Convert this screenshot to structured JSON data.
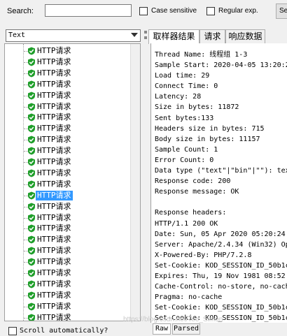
{
  "search": {
    "label": "Search:",
    "value": "",
    "case_sensitive_label": "Case sensitive",
    "regexp_label": "Regular exp.",
    "search_button_label": "Se"
  },
  "left": {
    "renderer_selected": "Text",
    "results": [
      "HTTP请求",
      "HTTP请求",
      "HTTP请求",
      "HTTP请求",
      "HTTP请求",
      "HTTP请求",
      "HTTP请求",
      "HTTP请求",
      "HTTP请求",
      "HTTP请求",
      "HTTP请求",
      "HTTP请求",
      "HTTP请求",
      "HTTP请求",
      "HTTP请求",
      "HTTP请求",
      "HTTP请求",
      "HTTP请求",
      "HTTP请求",
      "HTTP请求",
      "HTTP请求",
      "HTTP请求",
      "HTTP请求",
      "HTTP请求",
      "HTTP请求"
    ],
    "selected_index": 13,
    "scroll_auto_label": "Scroll automatically?"
  },
  "tabs": [
    "取样器结果",
    "请求",
    "响应数据"
  ],
  "result_lines": [
    "Thread Name: 线程组 1-3",
    "Sample Start: 2020-04-05 13:20:2",
    "Load time: 29",
    "Connect Time: 0",
    "Latency: 28",
    "Size in bytes: 11872",
    "Sent bytes:133",
    "Headers size in bytes: 715",
    "Body size in bytes: 11157",
    "Sample Count: 1",
    "Error Count: 0",
    "Data type (\"text\"|\"bin\"|\"\"): tex",
    "Response code: 200",
    "Response message: OK",
    "",
    "Response headers:",
    "HTTP/1.1 200 OK",
    "Date: Sun, 05 Apr 2020 05:20:24",
    "Server: Apache/2.4.34 (Win32) Op",
    "X-Powered-By: PHP/7.2.8",
    "Set-Cookie: KOD_SESSION_ID_50b1c",
    "Expires: Thu, 19 Nov 1981 08:52:",
    "Cache-Control: no-store, no-cach",
    "Pragma: no-cache",
    "Set-Cookie: KOD_SESSION_ID_50b1c",
    "Set-Cookie: KOD_SESSION_ID_50b1c"
  ],
  "bottom_tabs": [
    "Raw",
    "Parsed"
  ],
  "watermark": "https://blog.csdn.net/Tee_Simon"
}
